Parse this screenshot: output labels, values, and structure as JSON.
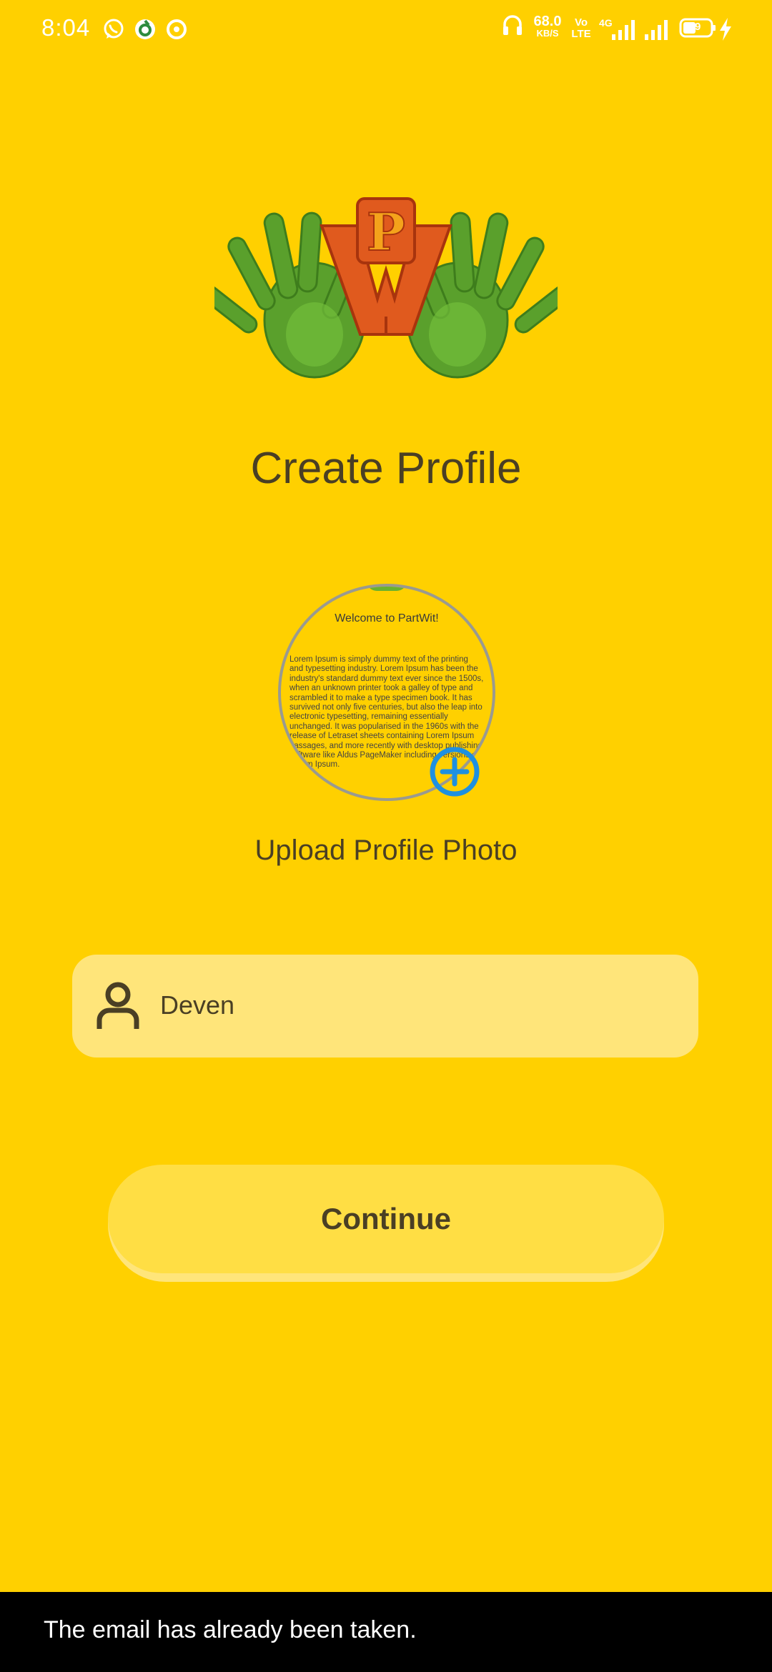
{
  "status_bar": {
    "time": "8:04",
    "net_speed_value": "68.0",
    "net_speed_unit": "KB/S",
    "volte": "Vo LTE",
    "network": "4G",
    "battery": "39",
    "icons": [
      "whatsapp-icon",
      "app-notification-icon",
      "sync-icon",
      "headset-icon",
      "signal-icon",
      "signal-icon",
      "charging-icon"
    ]
  },
  "header": {
    "logo_letter": "P",
    "title": "Create Profile"
  },
  "avatar": {
    "heading": "Welcome to PartWit!",
    "body": "Lorem Ipsum is simply dummy text of the printing and typesetting industry. Lorem Ipsum has been the industry's standard dummy text ever since the 1500s, when an unknown printer took a galley of type and scrambled it to make a type specimen book. It has survived not only five centuries, but also the leap into electronic typesetting, remaining essentially unchanged. It was popularised in the 1960s with the release of Letraset sheets containing Lorem Ipsum passages, and more recently with desktop publishing software like Aldus PageMaker including versions of Lorem Ipsum.",
    "upload_label": "Upload Profile Photo"
  },
  "form": {
    "name_value": "Deven",
    "continue_label": "Continue"
  },
  "snackbar": {
    "message": "The email has already been taken."
  },
  "colors": {
    "background": "#FFD000",
    "input_bg": "#FFE57A",
    "button_bg": "#FFDE44",
    "text": "#4a3f24",
    "accent_blue": "#1E90E0",
    "snackbar_bg": "#000000"
  }
}
